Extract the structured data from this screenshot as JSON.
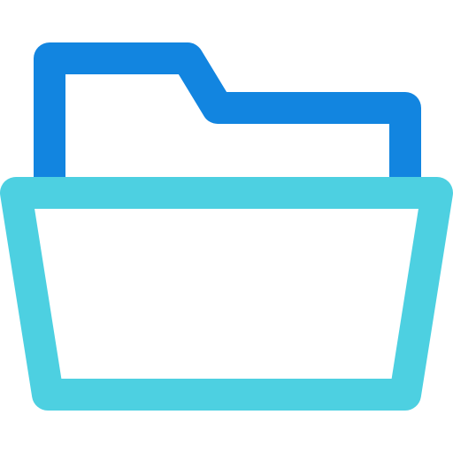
{
  "icon": {
    "name": "open-folder-icon",
    "colors": {
      "folder_back": "#1285e0",
      "folder_front": "#4dd0e1",
      "background": "#ffffff"
    }
  }
}
